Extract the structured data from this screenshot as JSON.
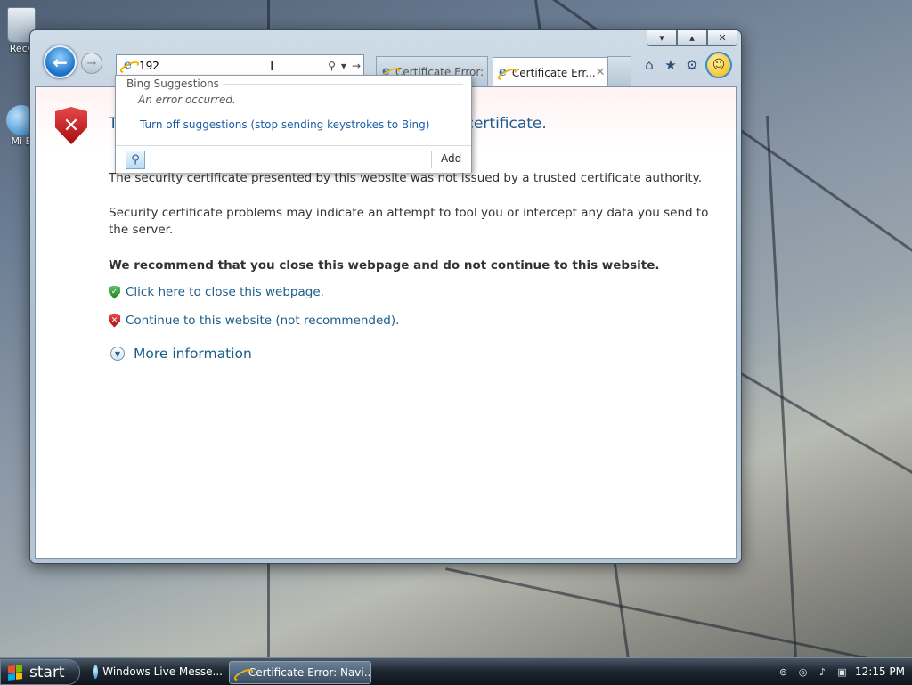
{
  "desktop": {
    "icons": [
      {
        "label": "Recy"
      },
      {
        "label": "Mi E"
      }
    ]
  },
  "window": {
    "caption": {
      "minimize": "▾",
      "maximize": "▴",
      "close": "✕"
    },
    "address": {
      "value": "192"
    },
    "tabs": [
      {
        "label": "Certificate Error: ..."
      },
      {
        "label": "Certificate Err...",
        "close": "✕"
      }
    ]
  },
  "suggestions": {
    "header": "Bing Suggestions",
    "error": "An error occurred.",
    "turn_off": "Turn off suggestions (stop sending keystrokes to Bing)",
    "add_label": "Add"
  },
  "page": {
    "title": "There is a problem with this website's security certificate.",
    "p1": "The security certificate presented by this website was not issued by a trusted certificate authority.",
    "p2": "Security certificate problems may indicate an attempt to fool you or intercept any data you send to the server.",
    "p3": "We recommend that you close this webpage and do not continue to this website.",
    "link_close": "Click here to close this webpage.",
    "link_continue": "Continue to this website (not recommended).",
    "more_info": "More information"
  },
  "taskbar": {
    "start_label": "start",
    "items": [
      {
        "label": "Windows Live Messe..."
      },
      {
        "label": "Certificate Error: Navi..."
      }
    ],
    "clock": "12:15 PM"
  }
}
